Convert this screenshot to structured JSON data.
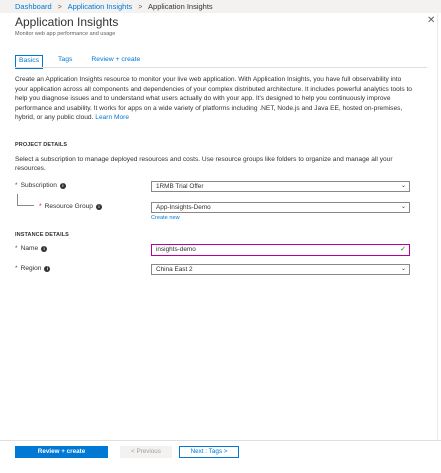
{
  "breadcrumb": {
    "items": [
      "Dashboard",
      "Application Insights"
    ],
    "current": "Application Insights",
    "separator": ">"
  },
  "blade": {
    "title": "Application Insights",
    "subtitle": "Monitor web app performance and usage",
    "close_icon": "close-icon"
  },
  "tabs": [
    {
      "label": "Basics",
      "active": true
    },
    {
      "label": "Tags",
      "active": false
    },
    {
      "label": "Review + create",
      "active": false
    }
  ],
  "intro": {
    "text": "Create an Application Insights resource to monitor your live web application. With Application Insights, you have full observability into your application across all components and dependencies of your complex distributed architecture. It includes powerful analytics tools to help you diagnose issues and to understand what users actually do with your app. It's designed to help you continuously improve performance and usability. It works for apps on a wide variety of platforms including .NET, Node.js and Java EE, hosted on-premises, hybrid, or any public cloud.",
    "link": "Learn More"
  },
  "project_details": {
    "title": "PROJECT DETAILS",
    "text": "Select a subscription to manage deployed resources and costs. Use resource groups like folders to organize and manage all your resources.",
    "subscription": {
      "label": "Subscription",
      "value": "1RMB Trial Offer"
    },
    "resource_group": {
      "label": "Resource Group",
      "value": "App-Insights-Demo",
      "create_new": "Create new"
    }
  },
  "instance_details": {
    "title": "INSTANCE DETAILS",
    "name": {
      "label": "Name",
      "value": "insights-demo"
    },
    "region": {
      "label": "Region",
      "value": "China East 2"
    }
  },
  "footer": {
    "review_create": "Review + create",
    "previous": "< Previous",
    "next": "Next : Tags >"
  },
  "colors": {
    "accent": "#0078d4",
    "required": "#a4262c",
    "valid": "#107c10",
    "focus_border": "#b4009e"
  }
}
